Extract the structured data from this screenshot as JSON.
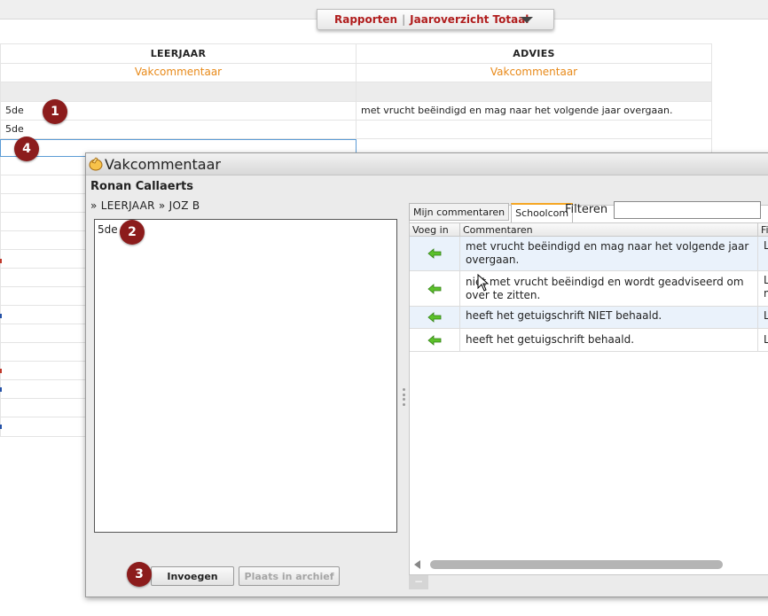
{
  "report_tab": {
    "label_rapporten": "Rapporten",
    "separator": "|",
    "label_overzicht": "Jaaroverzicht Totaal"
  },
  "grid": {
    "headers": [
      "LEERJAAR",
      "ADVIES"
    ],
    "subheaders": [
      "Vakcommentaar",
      "Vakcommentaar"
    ],
    "row1": {
      "leerjaar": "5de",
      "advies": "met vrucht beëindigd en mag naar het volgende jaar overgaan."
    },
    "row2": {
      "leerjaar": "5de"
    }
  },
  "badges": [
    "1",
    "2",
    "3",
    "4"
  ],
  "dialog": {
    "title": "Vakcommentaar",
    "student": "Ronan Callaerts",
    "breadcrumb": "» LEERJAAR » JOZ B",
    "textbox_value": "5de",
    "buttons": {
      "insert": "Invoegen",
      "archive": "Plaats in archief"
    },
    "tabs": [
      "Mijn commentaren",
      "Schoolcom"
    ],
    "filter_label": "Filteren",
    "filter_value": "",
    "columns": [
      "Voeg in",
      "Commentaren",
      "Fi"
    ],
    "comments": [
      {
        "text": "met vrucht beëindigd en mag naar het volgende jaar overgaan.",
        "extra": "L v"
      },
      {
        "text": "niet met vrucht beëindigd en wordt geadviseerd om over te zitten.",
        "extra": "L m"
      },
      {
        "text": "heeft het getuigschrift NIET behaald.",
        "extra": "L"
      },
      {
        "text": "heeft het getuigschrift behaald.",
        "extra": "L"
      }
    ],
    "minus_label": "−"
  },
  "colors": {
    "accent": "#b01d1d",
    "badge": "#8c1c1c",
    "orange": "#e88a1a",
    "row_alt": "#eaf2fb"
  }
}
